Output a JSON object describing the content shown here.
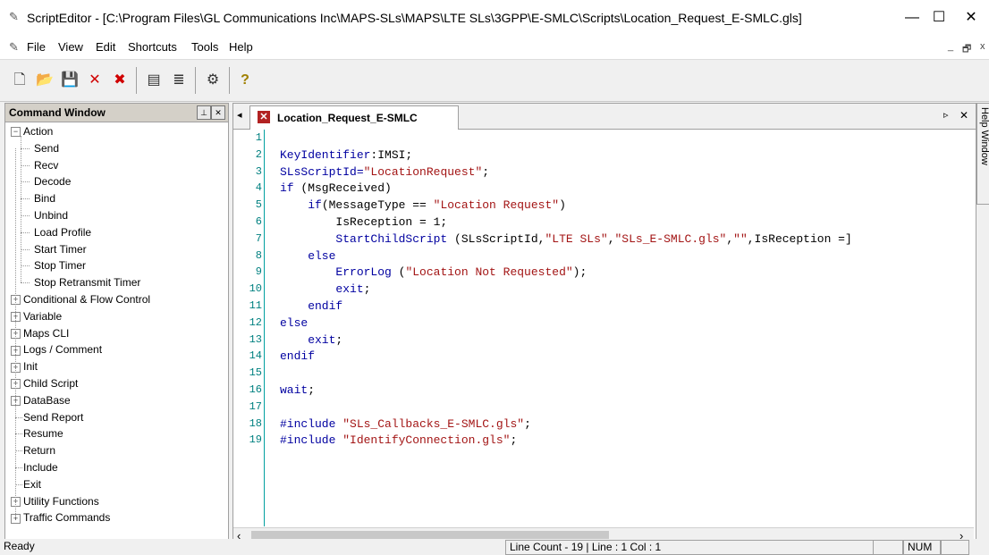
{
  "window": {
    "title": "ScriptEditor - [C:\\Program Files\\GL Communications Inc\\MAPS-SLs\\MAPS\\LTE SLs\\3GPP\\E-SMLC\\Scripts\\Location_Request_E-SMLC.gls]",
    "minimize": "—",
    "maximize": "☐",
    "close": "✕"
  },
  "menu": {
    "items": [
      "File",
      "View",
      "Edit",
      "Shortcuts",
      "Tools",
      "Help"
    ],
    "mdi_min": "_",
    "mdi_restore": "🗗",
    "mdi_close": "x"
  },
  "toolbar": {
    "new": "🗋",
    "open": "📂",
    "save": "💾",
    "delete": "✕",
    "delete_all": "✖",
    "properties": "▤",
    "align": "≣",
    "run": "⚙",
    "help": "?"
  },
  "command_window": {
    "title": "Command Window",
    "pin": "⊥",
    "close": "✕",
    "tree": [
      {
        "label": "Action",
        "expander": "−",
        "level": 0
      },
      {
        "label": "Send",
        "level": 1
      },
      {
        "label": "Recv",
        "level": 1
      },
      {
        "label": "Decode",
        "level": 1
      },
      {
        "label": "Bind",
        "level": 1
      },
      {
        "label": "Unbind",
        "level": 1
      },
      {
        "label": "Load Profile",
        "level": 1
      },
      {
        "label": "Start Timer",
        "level": 1
      },
      {
        "label": "Stop Timer",
        "level": 1
      },
      {
        "label": "Stop Retransmit Timer",
        "level": 1
      },
      {
        "label": "Conditional & Flow Control",
        "expander": "+",
        "level": 0
      },
      {
        "label": "Variable",
        "expander": "+",
        "level": 0
      },
      {
        "label": "Maps CLI",
        "expander": "+",
        "level": 0
      },
      {
        "label": "Logs / Comment",
        "expander": "+",
        "level": 0
      },
      {
        "label": "Init",
        "expander": "+",
        "level": 0
      },
      {
        "label": "Child Script",
        "expander": "+",
        "level": 0
      },
      {
        "label": "DataBase",
        "expander": "+",
        "level": 0
      },
      {
        "label": "Send Report",
        "level": 0
      },
      {
        "label": "Resume",
        "level": 0
      },
      {
        "label": "Return",
        "level": 0
      },
      {
        "label": "Include",
        "level": 0
      },
      {
        "label": "Exit",
        "level": 0
      },
      {
        "label": "Utility Functions",
        "expander": "+",
        "level": 0
      },
      {
        "label": "Traffic Commands",
        "expander": "+",
        "level": 0
      }
    ]
  },
  "editor": {
    "tab_label": "Location_Request_E-SMLC",
    "tab_scroll_left": "◂",
    "tab_scroll_right": "▹",
    "tab_close": "✕",
    "scroll_left": "‹",
    "scroll_right": "›",
    "line_numbers": [
      "1",
      "2",
      "3",
      "4",
      "5",
      "6",
      "7",
      "8",
      "9",
      "10",
      "11",
      "12",
      "13",
      "14",
      "15",
      "16",
      "17",
      "18",
      "19"
    ],
    "lines": [
      [],
      [
        {
          "t": "KeyIdentifier",
          "c": "kw"
        },
        {
          "t": ":IMSI;",
          "c": "plain"
        }
      ],
      [
        {
          "t": "SLsScriptId=",
          "c": "kw"
        },
        {
          "t": "\"LocationRequest\"",
          "c": "str"
        },
        {
          "t": ";",
          "c": "plain"
        }
      ],
      [
        {
          "t": "if ",
          "c": "kw"
        },
        {
          "t": "(MsgReceived)",
          "c": "plain"
        }
      ],
      [
        {
          "t": "    if",
          "c": "kw"
        },
        {
          "t": "(MessageType == ",
          "c": "plain"
        },
        {
          "t": "\"Location Request\"",
          "c": "str"
        },
        {
          "t": ")",
          "c": "plain"
        }
      ],
      [
        {
          "t": "        IsReception = 1;",
          "c": "plain"
        }
      ],
      [
        {
          "t": "        StartChildScript ",
          "c": "kw"
        },
        {
          "t": "(SLsScriptId,",
          "c": "plain"
        },
        {
          "t": "\"LTE SLs\"",
          "c": "str"
        },
        {
          "t": ",",
          "c": "plain"
        },
        {
          "t": "\"SLs_E-SMLC.gls\"",
          "c": "str"
        },
        {
          "t": ",",
          "c": "plain"
        },
        {
          "t": "\"\"",
          "c": "str"
        },
        {
          "t": ",IsReception =]",
          "c": "plain"
        }
      ],
      [
        {
          "t": "    else",
          "c": "kw"
        }
      ],
      [
        {
          "t": "        ErrorLog ",
          "c": "kw"
        },
        {
          "t": "(",
          "c": "plain"
        },
        {
          "t": "\"Location Not Requested\"",
          "c": "str"
        },
        {
          "t": ");",
          "c": "plain"
        }
      ],
      [
        {
          "t": "        exit",
          "c": "kw"
        },
        {
          "t": ";",
          "c": "plain"
        }
      ],
      [
        {
          "t": "    endif",
          "c": "kw"
        }
      ],
      [
        {
          "t": "else",
          "c": "kw"
        }
      ],
      [
        {
          "t": "    exit",
          "c": "kw"
        },
        {
          "t": ";",
          "c": "plain"
        }
      ],
      [
        {
          "t": "endif",
          "c": "kw"
        }
      ],
      [],
      [
        {
          "t": "wait",
          "c": "kw"
        },
        {
          "t": ";",
          "c": "plain"
        }
      ],
      [],
      [
        {
          "t": "#include ",
          "c": "kw"
        },
        {
          "t": "\"SLs_Callbacks_E-SMLC.gls\"",
          "c": "str"
        },
        {
          "t": ";",
          "c": "plain"
        }
      ],
      [
        {
          "t": "#include ",
          "c": "kw"
        },
        {
          "t": "\"IdentifyConnection.gls\"",
          "c": "str"
        },
        {
          "t": ";",
          "c": "plain"
        }
      ]
    ]
  },
  "help_window": {
    "label": "Help Window"
  },
  "status": {
    "ready": "Ready",
    "position": "Line Count - 19 | Line : 1 Col : 1",
    "blank": "",
    "num": "NUM",
    "blank2": ""
  }
}
